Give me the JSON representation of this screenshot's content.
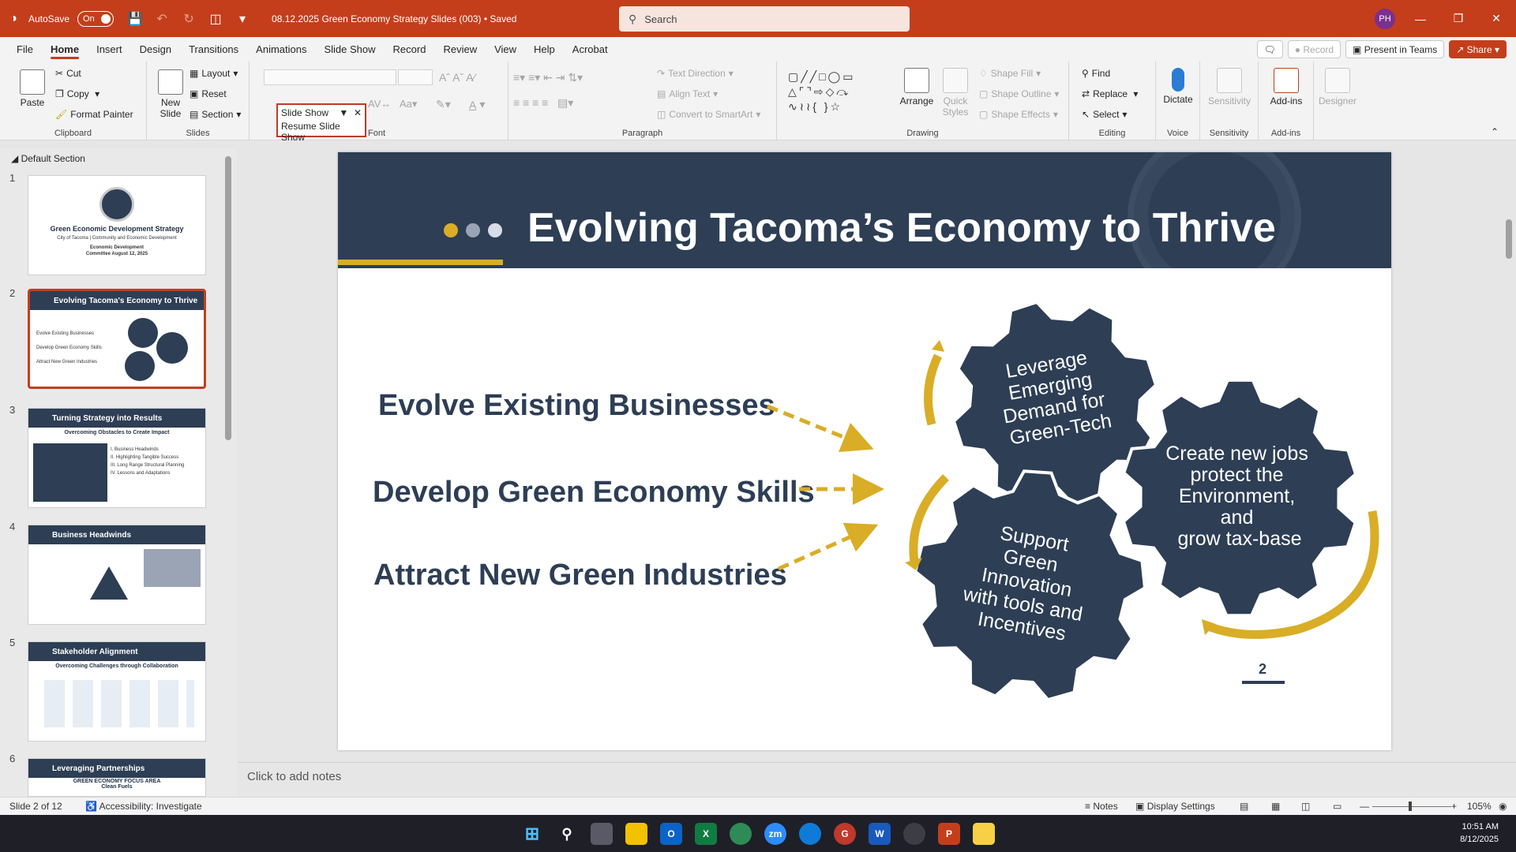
{
  "titlebar": {
    "autosave_label": "AutoSave",
    "toggle_label": "On",
    "filename": "08.12.2025 Green Economy Strategy Slides (003) • Saved",
    "search_placeholder": "Search",
    "avatar_initials": "PH"
  },
  "menu": {
    "tabs": [
      "File",
      "Home",
      "Insert",
      "Design",
      "Transitions",
      "Animations",
      "Slide Show",
      "Record",
      "Review",
      "View",
      "Help",
      "Acrobat"
    ],
    "active": "Home",
    "record": "Record",
    "present": "Present in Teams",
    "share": "Share"
  },
  "ribbon": {
    "clipboard": {
      "paste": "Paste",
      "cut": "Cut",
      "copy": "Copy",
      "format_painter": "Format Painter",
      "label": "Clipboard"
    },
    "slides": {
      "new_slide": "New Slide",
      "layout": "Layout",
      "reset": "Reset",
      "section": "Section",
      "label": "Slides"
    },
    "font": {
      "label": "Font"
    },
    "slideshow_popup": {
      "title": "Slide Show",
      "resume": "Resume Slide Show"
    },
    "paragraph": {
      "text_direction": "Text Direction",
      "align_text": "Align Text",
      "smartart": "Convert to SmartArt",
      "label": "Paragraph"
    },
    "drawing": {
      "arrange": "Arrange",
      "quick_styles": "Quick Styles",
      "shape_fill": "Shape Fill",
      "shape_outline": "Shape Outline",
      "shape_effects": "Shape Effects",
      "label": "Drawing"
    },
    "editing": {
      "find": "Find",
      "replace": "Replace",
      "select": "Select",
      "label": "Editing"
    },
    "voice": {
      "dictate": "Dictate",
      "label": "Voice"
    },
    "sensitivity": {
      "btn": "Sensitivity",
      "label": "Sensitivity"
    },
    "addins": {
      "btn": "Add-ins",
      "label": "Add-ins"
    },
    "designer": "Designer"
  },
  "thumbs": {
    "section": "Default Section",
    "numbers": [
      "1",
      "2",
      "3",
      "4",
      "5",
      "6"
    ],
    "s1_title": "Green Economic Development Strategy",
    "s1_sub": "City of Tacoma | Community and Economic Development",
    "s1_date": "Economic Development Committee August 12, 2025",
    "s2_title": "Evolving Tacoma's Economy to Thrive",
    "s2_items": [
      "Evolve Existing Businesses",
      "Develop Green Economy Skills",
      "Attract New Green Industries"
    ],
    "s3_title": "Turning Strategy into Results",
    "s3_sub": "Overcoming Obstacles to Create Impact",
    "s3_list": [
      "I. Business Headwinds",
      "II. Highlighting Tangible Success",
      "III. Long Range Structural Planning",
      "IV. Lessons and Adaptations"
    ],
    "s4_title": "Business Headwinds",
    "s5_title": "Stakeholder Alignment",
    "s5_sub": "Overcoming Challenges through Collaboration",
    "s6_title": "Leveraging Partnerships",
    "s6_sub": "GREEN ECONOMY FOCUS AREA",
    "s6_sub2": "Clean Fuels"
  },
  "slide": {
    "title": "Evolving Tacoma’s Economy to Thrive",
    "points": [
      "Evolve Existing Businesses",
      "Develop Green Economy Skills",
      "Attract New Green Industries"
    ],
    "gear1": [
      "Leverage",
      "Emerging",
      "Demand for",
      "Green-Tech"
    ],
    "gear2": [
      "Create new jobs",
      "protect the",
      "Environment,",
      "and",
      "grow tax-base"
    ],
    "gear3": [
      "Support",
      "Green",
      "Innovation",
      "with tools and",
      "Incentives"
    ],
    "page_number": "2",
    "colors": {
      "navy": "#2d3e55",
      "gold": "#d9ad26",
      "dot_gray": "#9aa4b5"
    }
  },
  "notes": {
    "placeholder": "Click to add notes"
  },
  "status": {
    "slide_of": "Slide 2 of 12",
    "accessibility": "Accessibility: Investigate",
    "notes": "Notes",
    "display": "Display Settings",
    "zoom": "105%"
  },
  "clock": {
    "time": "10:51 AM",
    "date": "8/12/2025"
  }
}
